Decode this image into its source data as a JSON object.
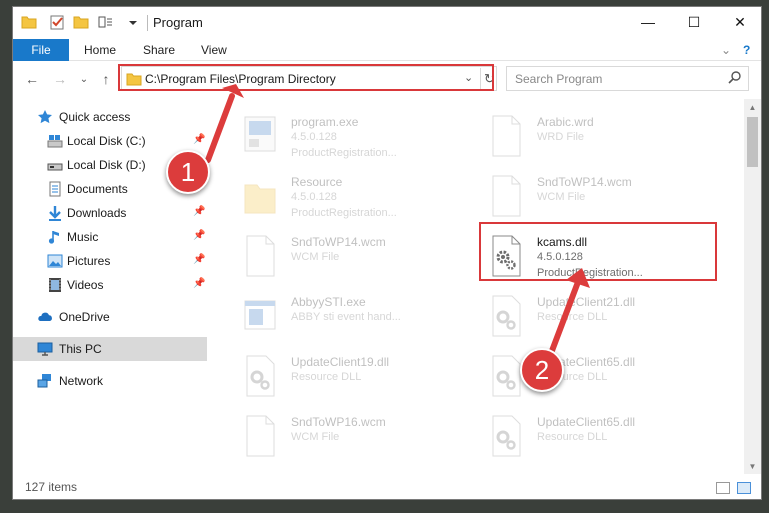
{
  "window": {
    "title": "Program",
    "minimize_glyph": "—",
    "maximize_glyph": "☐",
    "close_glyph": "✕"
  },
  "ribbon": {
    "tabs": [
      "File",
      "Home",
      "Share",
      "View"
    ],
    "expand_glyph": "⌄",
    "help_glyph": "?"
  },
  "navigation": {
    "back_glyph": "←",
    "forward_glyph": "→",
    "recent_glyph": "⌄",
    "up_glyph": "↑"
  },
  "address_bar": {
    "path": "C:\\Program Files\\Program Directory",
    "dropdown_glyph": "⌄",
    "refresh_glyph": "↻"
  },
  "search": {
    "placeholder": "Search Program"
  },
  "nav_pane": {
    "items": [
      {
        "label": "Quick access",
        "icon": "star-icon",
        "pinned": false
      },
      {
        "label": "Local Disk (C:)",
        "icon": "drive-icon",
        "pinned": true
      },
      {
        "label": "Local Disk (D:)",
        "icon": "drive-icon",
        "pinned": true
      },
      {
        "label": "Documents",
        "icon": "documents-icon",
        "pinned": true
      },
      {
        "label": "Downloads",
        "icon": "download-icon",
        "pinned": true
      },
      {
        "label": "Music",
        "icon": "music-icon",
        "pinned": true
      },
      {
        "label": "Pictures",
        "icon": "pictures-icon",
        "pinned": true
      },
      {
        "label": "Videos",
        "icon": "videos-icon",
        "pinned": true
      },
      {
        "label": "OneDrive",
        "icon": "cloud-icon",
        "pinned": false
      },
      {
        "label": "This PC",
        "icon": "computer-icon",
        "pinned": false,
        "selected": true
      },
      {
        "label": "Network",
        "icon": "network-icon",
        "pinned": false
      }
    ],
    "pin_glyph": "📌"
  },
  "files": [
    {
      "name": "program.exe",
      "line1": "4.5.0.128",
      "line2": "ProductRegistration...",
      "icon": "exe-icon",
      "faded": true
    },
    {
      "name": "Arabic.wrd",
      "line1": "WRD File",
      "line2": "",
      "icon": "blank-file-icon",
      "faded": true
    },
    {
      "name": "Resource",
      "line1": "4.5.0.128",
      "line2": "ProductRegistration...",
      "icon": "folder-icon",
      "faded": true
    },
    {
      "name": "SndToWP14.wcm",
      "line1": "WCM File",
      "line2": "",
      "icon": "blank-file-icon",
      "faded": true
    },
    {
      "name": "SndToWP14.wcm",
      "line1": "WCM File",
      "line2": "",
      "icon": "blank-file-icon",
      "faded": true
    },
    {
      "name": "kcams.dll",
      "line1": "4.5.0.128",
      "line2": "ProductRegistration...",
      "icon": "dll-gear-icon",
      "faded": false
    },
    {
      "name": "AbbyySTI.exe",
      "line1": "ABBY sti event hand...",
      "line2": "",
      "icon": "app-window-icon",
      "faded": true
    },
    {
      "name": "UpdateClient21.dll",
      "line1": "Resource DLL",
      "line2": "",
      "icon": "dll-gear-icon",
      "faded": true
    },
    {
      "name": "UpdateClient19.dll",
      "line1": "Resource DLL",
      "line2": "",
      "icon": "dll-gear-icon",
      "faded": true
    },
    {
      "name": "UpdateClient65.dll",
      "line1": "Resource DLL",
      "line2": "",
      "icon": "dll-gear-icon",
      "faded": true
    },
    {
      "name": "SndToWP16.wcm",
      "line1": "WCM File",
      "line2": "",
      "icon": "blank-file-icon",
      "faded": true
    },
    {
      "name": "UpdateClient65.dll",
      "line1": "Resource DLL",
      "line2": "",
      "icon": "dll-gear-icon",
      "faded": true
    }
  ],
  "status": {
    "item_count": "127 items"
  },
  "callouts": [
    {
      "number": "1"
    },
    {
      "number": "2"
    }
  ],
  "colors": {
    "ribbon_file_tab": "#1979ca",
    "highlight_red": "#d9383a",
    "badge_red": "#dc3c3c",
    "selected_nav": "#d9d9d9"
  }
}
